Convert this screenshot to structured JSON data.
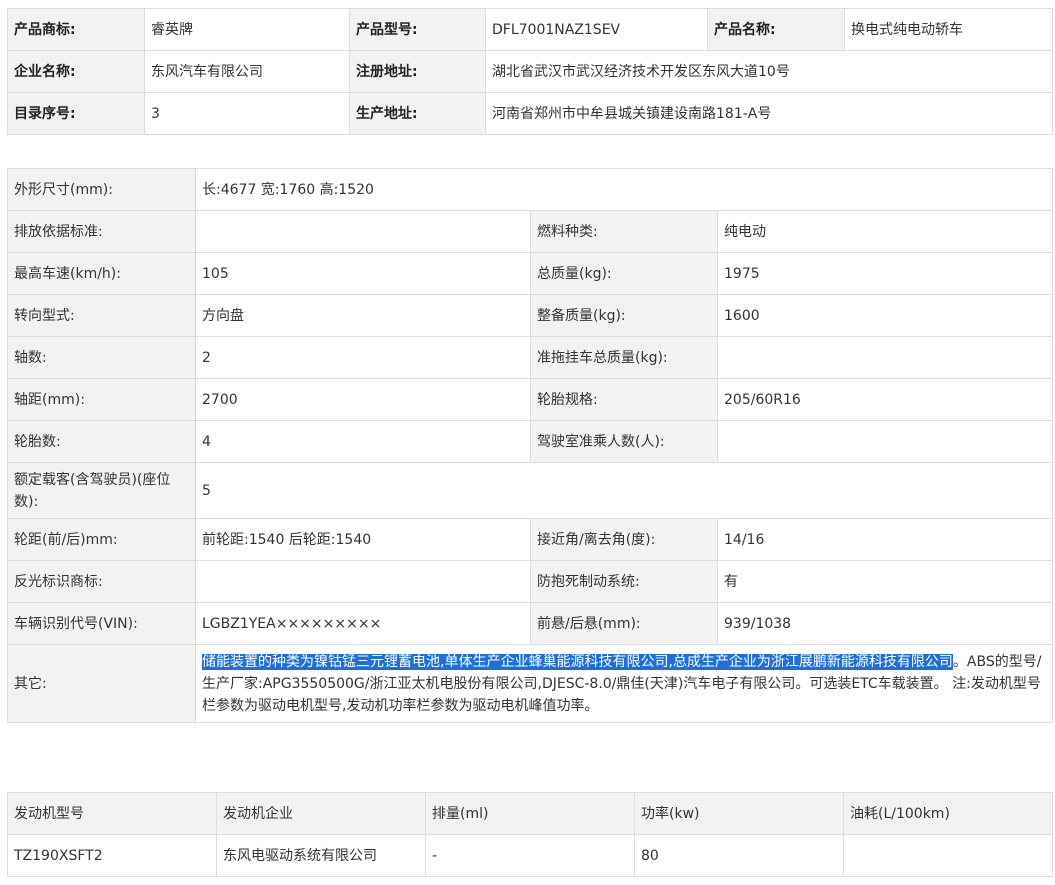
{
  "product": {
    "brand_label": "产品商标:",
    "brand": "睿英牌",
    "model_label": "产品型号:",
    "model": "DFL7001NAZ1SEV",
    "name_label": "产品名称:",
    "name": "换电式纯电动轿车",
    "company_label": "企业名称:",
    "company": "东风汽车有限公司",
    "reg_addr_label": "注册地址:",
    "reg_addr": "湖北省武汉市武汉经济技术开发区东风大道10号",
    "catalog_label": "目录序号:",
    "catalog": "3",
    "prod_addr_label": "生产地址:",
    "prod_addr": "河南省郑州市中牟县城关镇建设南路181-A号"
  },
  "specs": {
    "dims_label": "外形尺寸(mm):",
    "dims": "长:4677 宽:1760 高:1520",
    "emission_label": "排放依据标准:",
    "emission": "",
    "fuel_label": "燃料种类:",
    "fuel": "纯电动",
    "speed_label": "最高车速(km/h):",
    "speed": "105",
    "total_mass_label": "总质量(kg):",
    "total_mass": "1975",
    "steering_label": "转向型式:",
    "steering": "方向盘",
    "curb_mass_label": "整备质量(kg):",
    "curb_mass": "1600",
    "axles_label": "轴数:",
    "axles": "2",
    "trailer_label": "准拖挂车总质量(kg):",
    "trailer": "",
    "wheelbase_label": "轴距(mm):",
    "wheelbase": "2700",
    "tire_spec_label": "轮胎规格:",
    "tire_spec": "205/60R16",
    "tires_label": "轮胎数:",
    "tires": "4",
    "cab_label": "驾驶室准乘人数(人):",
    "cab": "",
    "seats_label": "额定载客(含驾驶员)(座位数):",
    "seats": "5",
    "track_label": "轮距(前/后)mm:",
    "track": "前轮距:1540 后轮距:1540",
    "angles_label": "接近角/离去角(度):",
    "angles": "14/16",
    "reflect_label": "反光标识商标:",
    "reflect": "",
    "abs_label": "防抱死制动系统:",
    "abs": "有",
    "vin_label": "车辆识别代号(VIN):",
    "vin": "LGBZ1YEA×××××××××",
    "overhang_label": "前悬/后悬(mm):",
    "overhang": "939/1038",
    "other_label": "其它:",
    "other_selected": "储能装置的种类为镍钴锰三元锂蓄电池,单体生产企业蜂巢能源科技有限公司,总成生产企业为浙江展鹏新能源科技有限公司",
    "other_rest": "。ABS的型号/生产厂家:APG3550500G/浙江亚太机电股份有限公司,DJESC-8.0/鼎佳(天津)汽车电子有限公司。可选装ETC车载装置。 注:发动机型号栏参数为驱动电机型号,发动机功率栏参数为驱动电机峰值功率。"
  },
  "engine_table": {
    "headers": [
      "发动机型号",
      "发动机企业",
      "排量(ml)",
      "功率(kw)",
      "油耗(L/100km)"
    ],
    "row": [
      "TZ190XSFT2",
      "东风电驱动系统有限公司",
      "-",
      "80",
      ""
    ]
  },
  "colors": {
    "label_bg": "#f2f2f2",
    "border": "#dddddd",
    "selection": "#1e6fd6"
  }
}
